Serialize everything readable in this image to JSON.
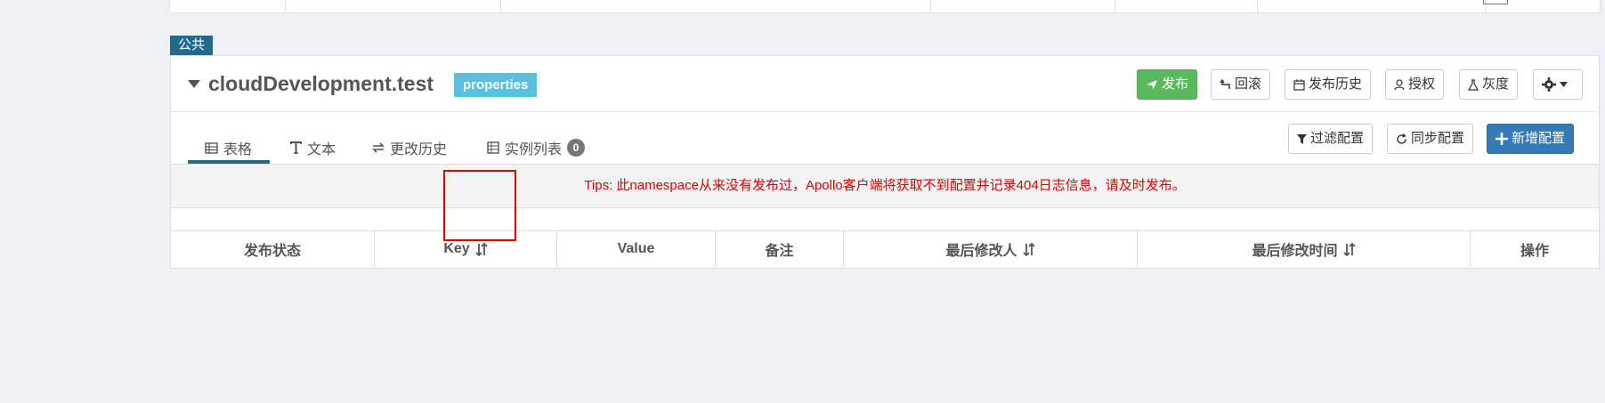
{
  "namespace_tag": "公共",
  "namespace": {
    "name": "cloudDevelopment.test",
    "format": "properties"
  },
  "actions": {
    "publish": "发布",
    "rollback": "回滚",
    "history": "发布历史",
    "authorize": "授权",
    "gray": "灰度"
  },
  "tabs": {
    "table": "表格",
    "text": "文本",
    "change_history": "更改历史",
    "instances": "实例列表",
    "instances_count": "0"
  },
  "toolbar": {
    "filter": "过滤配置",
    "sync": "同步配置",
    "add": "新增配置"
  },
  "tips": "Tips: 此namespace从来没有发布过，Apollo客户端将获取不到配置并记录404日志信息，请及时发布。",
  "table": {
    "headers": {
      "status": "发布状态",
      "key": "Key",
      "value": "Value",
      "comment": "备注",
      "modifier": "最后修改人",
      "modified_time": "最后修改时间",
      "operation": "操作"
    }
  },
  "colors": {
    "accent": "#216a8b",
    "publish": "#5cb85c",
    "primary": "#337ab7",
    "tips": "#e00000",
    "format_badge": "#5bc0de"
  }
}
